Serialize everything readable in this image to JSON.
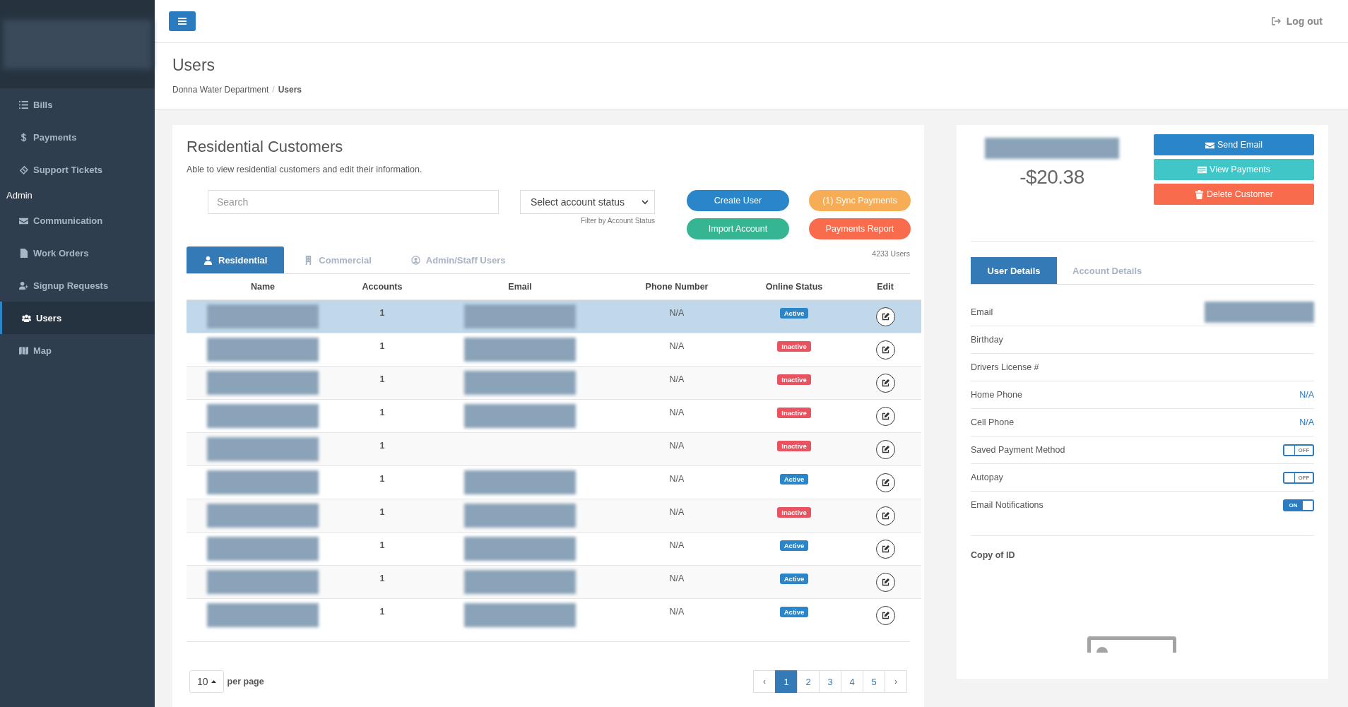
{
  "topbar": {
    "logout": "Log out"
  },
  "sidebar": {
    "logo_redacted": true,
    "items": [
      {
        "kind": "link",
        "label": "Bills",
        "selected": false
      },
      {
        "kind": "link",
        "label": "Payments",
        "selected": false
      },
      {
        "kind": "link",
        "label": "Support Tickets",
        "selected": false
      },
      {
        "kind": "heading",
        "label": "Admin"
      },
      {
        "kind": "link",
        "label": "Communication",
        "selected": false
      },
      {
        "kind": "link",
        "label": "Work Orders",
        "selected": false
      },
      {
        "kind": "link",
        "label": "Signup Requests",
        "selected": false
      },
      {
        "kind": "link",
        "label": "Users",
        "selected": true
      },
      {
        "kind": "link",
        "label": "Map",
        "selected": false
      }
    ]
  },
  "page": {
    "title": "Users",
    "breadcrumb_separator": "/",
    "breadcrumb": [
      {
        "label": "Donna Water Department",
        "current": false
      },
      {
        "label": "Users",
        "current": true
      }
    ]
  },
  "customers": {
    "title": "Residential Customers",
    "description": "Able to view residential customers and edit their information.",
    "search": {
      "placeholder": "Search"
    },
    "status_select": {
      "value": "Select account status",
      "hint": "Filter by Account Status"
    },
    "buttons": [
      {
        "label": "Create User",
        "kind": "primary"
      },
      {
        "label": "(1) Sync Payments",
        "kind": "warning"
      },
      {
        "label": "Import Account",
        "kind": "success"
      },
      {
        "label": "Payments Report",
        "kind": "danger"
      }
    ],
    "user_count": "4233 Users",
    "tabs": [
      {
        "label": "Residential",
        "selected": true
      },
      {
        "label": "Commercial",
        "selected": false
      },
      {
        "label": "Admin/Staff Users",
        "selected": false
      }
    ],
    "table": {
      "columns": [
        "Name",
        "Accounts",
        "Email",
        "Phone Number",
        "Online Status",
        "Edit"
      ],
      "rows": [
        {
          "selected": true,
          "name_redacted": true,
          "accounts": "1",
          "email_redacted": true,
          "phone": "N/A",
          "status": {
            "label": "Active",
            "kind": "active"
          }
        },
        {
          "selected": false,
          "name_redacted": true,
          "accounts": "1",
          "email_redacted": true,
          "phone": "N/A",
          "status": {
            "label": "Inactive",
            "kind": "inactive"
          }
        },
        {
          "selected": false,
          "name_redacted": true,
          "accounts": "1",
          "email_redacted": true,
          "phone": "N/A",
          "status": {
            "label": "Inactive",
            "kind": "inactive"
          }
        },
        {
          "selected": false,
          "name_redacted": true,
          "accounts": "1",
          "email_redacted": true,
          "phone": "N/A",
          "status": {
            "label": "Inactive",
            "kind": "inactive"
          }
        },
        {
          "selected": false,
          "name_redacted": true,
          "accounts": "1",
          "email_redacted": false,
          "phone": "N/A",
          "status": {
            "label": "Inactive",
            "kind": "inactive"
          }
        },
        {
          "selected": false,
          "name_redacted": true,
          "accounts": "1",
          "email_redacted": true,
          "phone": "N/A",
          "status": {
            "label": "Active",
            "kind": "active"
          }
        },
        {
          "selected": false,
          "name_redacted": true,
          "accounts": "1",
          "email_redacted": true,
          "phone": "N/A",
          "status": {
            "label": "Inactive",
            "kind": "inactive"
          }
        },
        {
          "selected": false,
          "name_redacted": true,
          "accounts": "1",
          "email_redacted": true,
          "phone": "N/A",
          "status": {
            "label": "Active",
            "kind": "active"
          }
        },
        {
          "selected": false,
          "name_redacted": true,
          "accounts": "1",
          "email_redacted": true,
          "phone": "N/A",
          "status": {
            "label": "Active",
            "kind": "active"
          }
        },
        {
          "selected": false,
          "name_redacted": true,
          "accounts": "1",
          "email_redacted": true,
          "phone": "N/A",
          "status": {
            "label": "Active",
            "kind": "active"
          }
        }
      ]
    },
    "per_page": {
      "value": "10",
      "label": "per page"
    },
    "pagination": {
      "prev": "‹",
      "next": "›",
      "pages": [
        {
          "label": "1",
          "selected": true
        },
        {
          "label": "2",
          "selected": false
        },
        {
          "label": "3",
          "selected": false
        },
        {
          "label": "4",
          "selected": false
        },
        {
          "label": "5",
          "selected": false
        }
      ]
    }
  },
  "customer_panel": {
    "name_redacted": true,
    "balance": "-$20.38",
    "actions": [
      {
        "label": "Send Email",
        "kind": "primary"
      },
      {
        "label": "View Payments",
        "kind": "info"
      },
      {
        "label": "Delete Customer",
        "kind": "danger"
      }
    ],
    "tabs": [
      {
        "label": "User Details",
        "selected": true
      },
      {
        "label": "Account Details",
        "selected": false
      }
    ],
    "details": [
      {
        "kind": "text",
        "label": "Email",
        "value_redacted": true
      },
      {
        "kind": "text",
        "label": "Birthday"
      },
      {
        "kind": "text",
        "label": "Drivers License #"
      },
      {
        "kind": "link",
        "label": "Home Phone",
        "value": "N/A"
      },
      {
        "kind": "link",
        "label": "Cell Phone",
        "value": "N/A"
      },
      {
        "kind": "toggle",
        "label": "Saved Payment Method",
        "on": false,
        "state_label": "OFF"
      },
      {
        "kind": "toggle",
        "label": "Autopay",
        "on": false,
        "state_label": "OFF"
      },
      {
        "kind": "toggle",
        "label": "Email Notifications",
        "on": true,
        "state_label": "ON"
      }
    ],
    "copy_of_id": {
      "title": "Copy of ID"
    }
  }
}
